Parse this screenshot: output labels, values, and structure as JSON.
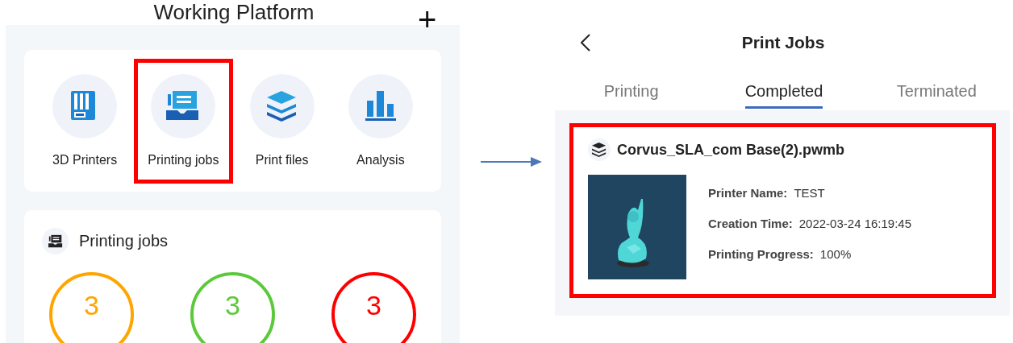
{
  "left_screen": {
    "title": "Working Platform",
    "add_button": "+",
    "shortcuts": [
      {
        "kind": "printer",
        "label": "3D Printers",
        "highlighted": false
      },
      {
        "kind": "jobs",
        "label": "Printing jobs",
        "highlighted": true
      },
      {
        "kind": "files",
        "label": "Print files",
        "highlighted": false
      },
      {
        "kind": "analysis",
        "label": "Analysis",
        "highlighted": false
      }
    ],
    "jobs_section": {
      "title": "Printing jobs",
      "counts": [
        {
          "value": "3",
          "color": "#ffa500"
        },
        {
          "value": "3",
          "color": "#5cc93b"
        },
        {
          "value": "3",
          "color": "#ff0000"
        }
      ]
    }
  },
  "right_screen": {
    "title": "Print Jobs",
    "tabs": [
      {
        "label": "Printing",
        "selected": false
      },
      {
        "label": "Completed",
        "selected": true
      },
      {
        "label": "Terminated",
        "selected": false
      }
    ],
    "jobs": [
      {
        "file": "Corvus_SLA_com Base(2).pwmb",
        "highlighted": true,
        "thumbnail": {
          "kind": "picture"
        },
        "fields": [
          {
            "label": "Printer Name:",
            "value": "TEST"
          },
          {
            "label": "Creation Time:",
            "value": "2022-03-24 16:19:45"
          },
          {
            "label": "Printing Progress:",
            "value": "100%"
          }
        ]
      }
    ]
  }
}
